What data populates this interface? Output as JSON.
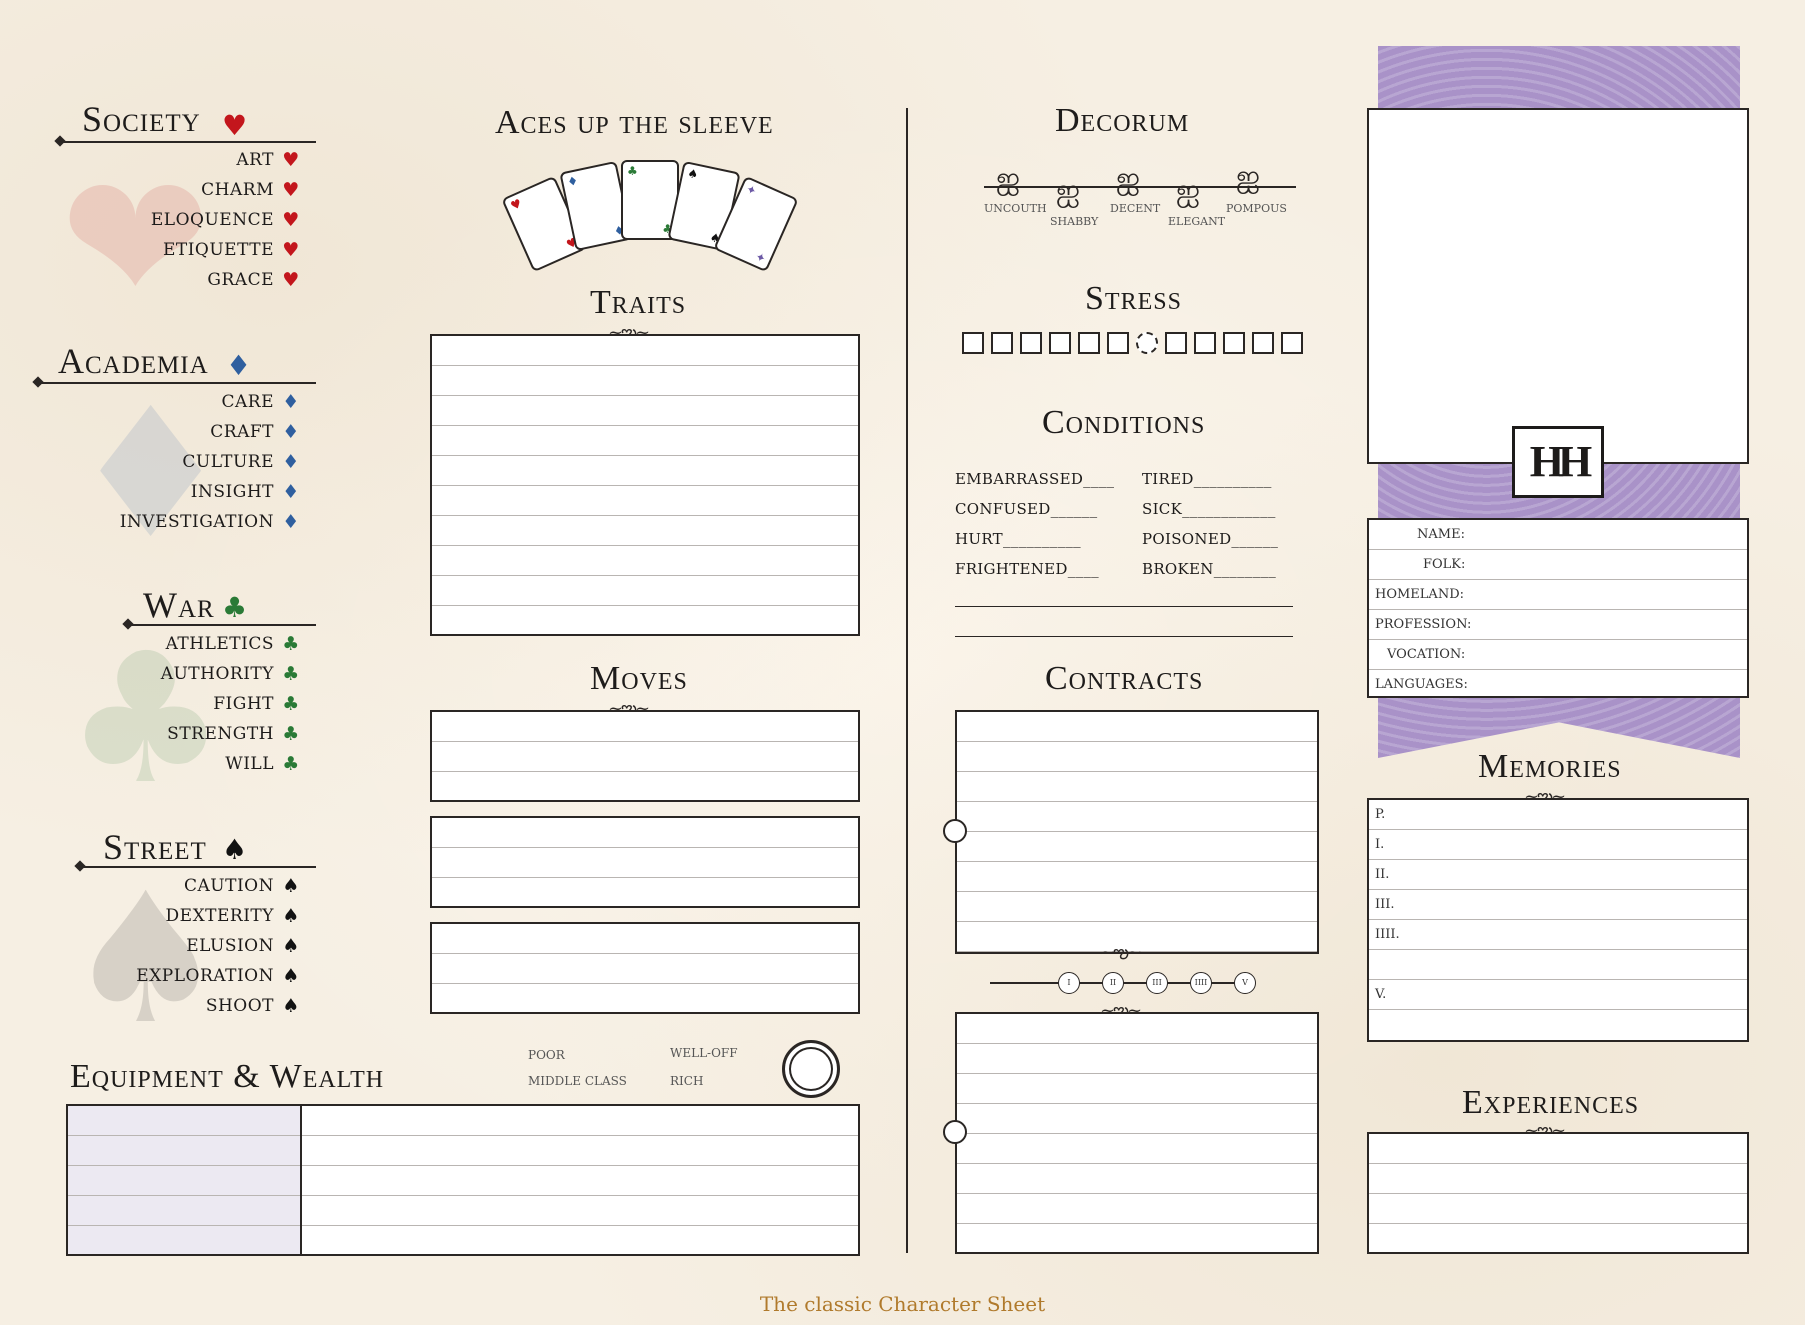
{
  "colors": {
    "heart": "#c3161c",
    "diamond": "#2f5f9f",
    "club": "#2a7a36",
    "spade": "#121212",
    "banner": "#a992c8",
    "footer": "#b07a2c"
  },
  "society": {
    "title": "Society",
    "icon": "heart-icon",
    "skills": [
      "ART",
      "CHARM",
      "ELOQUENCE",
      "ETIQUETTE",
      "GRACE"
    ]
  },
  "academia": {
    "title": "Academia",
    "icon": "diamond-icon",
    "skills": [
      "CARE",
      "CRAFT",
      "CULTURE",
      "INSIGHT",
      "INVESTIGATION"
    ]
  },
  "war": {
    "title": "War",
    "icon": "club-icon",
    "skills": [
      "ATHLETICS",
      "AUTHORITY",
      "FIGHT",
      "STRENGTH",
      "WILL"
    ]
  },
  "street": {
    "title": "Street",
    "icon": "spade-icon",
    "skills": [
      "CAUTION",
      "DEXTERITY",
      "ELUSION",
      "EXPLORATION",
      "SHOOT"
    ]
  },
  "aces": {
    "title": "Aces up the sleeve"
  },
  "traits": {
    "title": "Traits"
  },
  "moves": {
    "title": "Moves"
  },
  "equipment": {
    "title": "Equipment & Wealth",
    "wealth": [
      "POOR",
      "WELL-OFF",
      "MIDDLE CLASS",
      "RICH"
    ]
  },
  "decorum": {
    "title": "Decorum",
    "levels": [
      "UNCOUTH",
      "SHABBY",
      "DECENT",
      "ELEGANT",
      "POMPOUS"
    ]
  },
  "stress": {
    "title": "Stress",
    "count": 12
  },
  "conditions": {
    "title": "Conditions",
    "left": [
      "EMBARRASSED",
      "CONFUSED",
      "HURT",
      "FRIGHTENED"
    ],
    "right": [
      "TIRED",
      "SICK",
      "POISONED",
      "BROKEN"
    ]
  },
  "contracts": {
    "title": "Contracts",
    "chips": [
      "I",
      "II",
      "III",
      "IIII",
      "V"
    ]
  },
  "profile": {
    "logo": "HH",
    "fields": [
      "NAME:",
      "FOLK:",
      "HOMELAND:",
      "PROFESSION:",
      "VOCATION:",
      "LANGUAGES:"
    ]
  },
  "memories": {
    "title": "Memories",
    "rows": [
      "P.",
      "I.",
      "II.",
      "III.",
      "IIII.",
      "",
      "V."
    ]
  },
  "experiences": {
    "title": "Experiences"
  },
  "footer": "The classic Character Sheet"
}
